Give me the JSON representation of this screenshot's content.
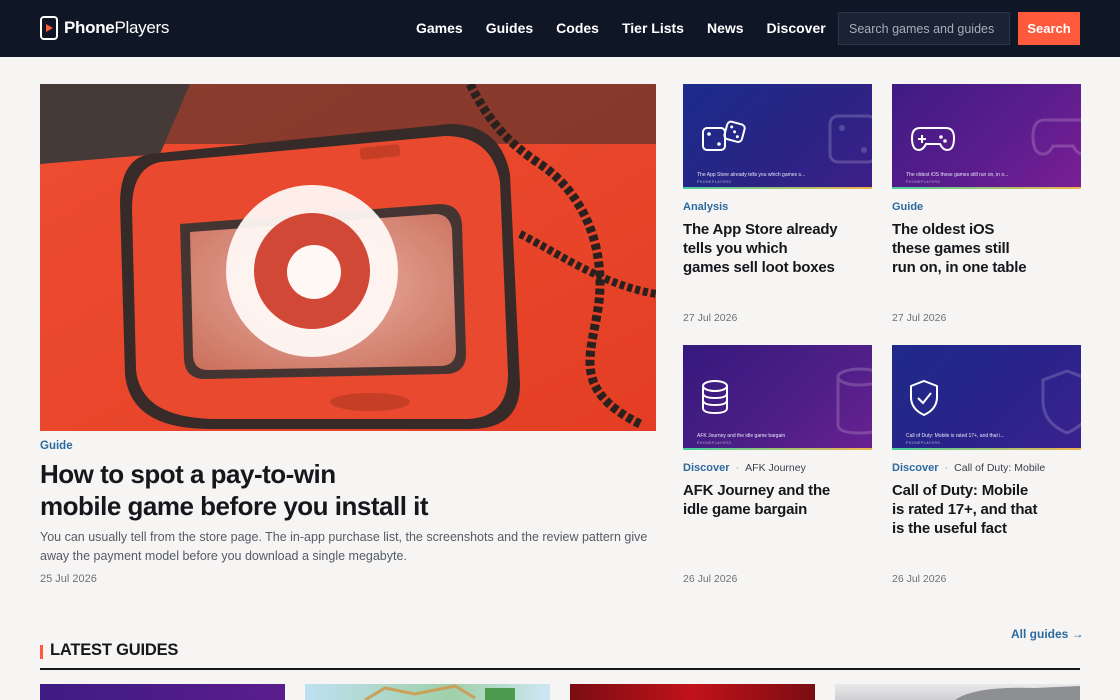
{
  "header": {
    "brand_bold": "Phone",
    "brand_rest": "Players",
    "nav": [
      "Games",
      "Guides",
      "Codes",
      "Tier Lists",
      "News",
      "Discover"
    ],
    "search_placeholder": "Search games and guides",
    "search_button": "Search"
  },
  "hero": {
    "category": "Guide",
    "title_line1": "How to spot a pay-to-win",
    "title_line2": "mobile game before you install it",
    "description_line1": "You can usually tell from the store page. The in-app purchase list, the screenshots and the review pattern give",
    "description_line2": "away the payment model before you download a single megabyte.",
    "date": "25 Jul 2026"
  },
  "cards": [
    {
      "category": "Analysis",
      "tag": "",
      "title_lines": [
        "The App Store already",
        "tells you which",
        "games sell loot boxes"
      ],
      "image_caption": "The App Store already tells you which games s...",
      "image_icon": "dice-icon",
      "date": "27 Jul 2026"
    },
    {
      "category": "Guide",
      "tag": "",
      "title_lines": [
        "The oldest iOS",
        "these games still",
        "run on, in one table"
      ],
      "image_caption": "The oldest iOS these games still run on, in o...",
      "image_icon": "gamepad-icon",
      "date": "27 Jul 2026"
    },
    {
      "category": "Discover",
      "tag": "AFK Journey",
      "title_lines": [
        "AFK Journey and the",
        "idle game bargain"
      ],
      "image_caption": "AFK Journey and the idle game bargain",
      "image_icon": "coins-icon",
      "date": "26 Jul 2026"
    },
    {
      "category": "Discover",
      "tag": "Call of Duty: Mobile",
      "title_lines": [
        "Call of Duty: Mobile",
        "is rated 17+, and that",
        "is the useful fact"
      ],
      "image_caption": "Call of Duty: Mobile is rated 17+, and that i...",
      "image_icon": "shield-check-icon",
      "date": "26 Jul 2026"
    }
  ],
  "image_brand": "PHONEPLAYERS",
  "latest": {
    "title": "LATEST GUIDES",
    "all_link": "All guides →"
  },
  "colors": {
    "header_bg": "#0f1626",
    "accent": "#ff5a3c",
    "category": "#2d6a9f",
    "page_bg": "#f6f5f3"
  }
}
